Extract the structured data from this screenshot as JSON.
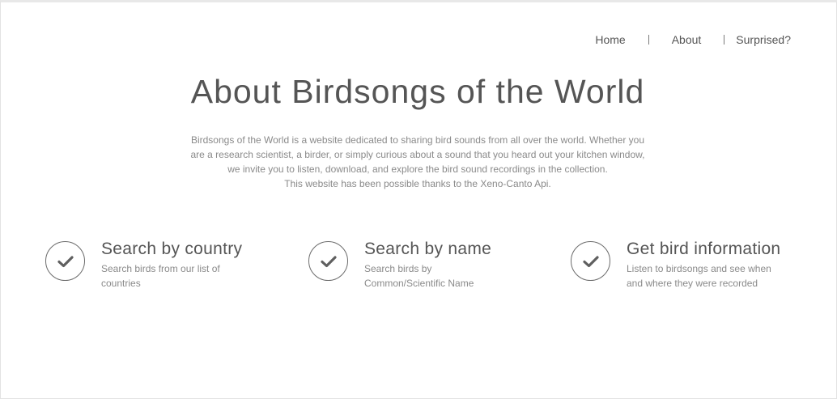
{
  "nav": {
    "items": [
      {
        "label": "Home"
      },
      {
        "label": "About"
      },
      {
        "label": "Surprised?"
      }
    ]
  },
  "page": {
    "title": "About Birdsongs of the World",
    "intro_lines": [
      "Birdsongs of the World is a website dedicated to sharing bird sounds from all over the world. Whether you",
      "are a research scientist, a birder, or simply curious about a sound that you heard out your kitchen window,",
      "we invite you to listen, download, and explore the bird sound recordings in the collection.",
      "This website has been possible thanks to the Xeno-Canto Api."
    ]
  },
  "features": [
    {
      "icon": "check-icon",
      "title": "Search by country",
      "desc_lines": [
        "Search birds from our list of",
        "countries"
      ]
    },
    {
      "icon": "check-icon",
      "title": "Search by name",
      "desc_lines": [
        "Search birds by",
        "Common/Scientific Name"
      ]
    },
    {
      "icon": "check-icon",
      "title": "Get bird information",
      "desc_lines": [
        "Listen to birdsongs and see when",
        "and where they were recorded"
      ]
    }
  ]
}
